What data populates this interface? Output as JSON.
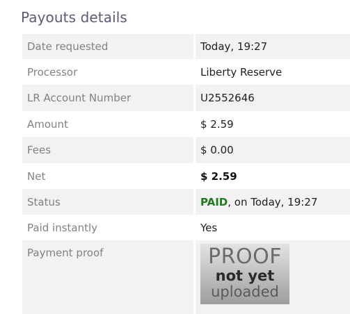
{
  "section": {
    "title": "Payouts details"
  },
  "rows": {
    "date_requested": {
      "label": "Date requested",
      "value": "Today, 19:27"
    },
    "processor": {
      "label": "Processor",
      "value": "Liberty Reserve"
    },
    "account": {
      "label": "LR Account Number",
      "value": "U2552646"
    },
    "amount": {
      "label": "Amount",
      "value": "$ 2.59"
    },
    "fees": {
      "label": "Fees",
      "value": "$ 0.00"
    },
    "net": {
      "label": "Net",
      "value": "$ 2.59"
    },
    "status": {
      "label": "Status",
      "status_word": "PAID",
      "status_suffix": ", on Today, 19:27"
    },
    "paid_instantly": {
      "label": "Paid instantly",
      "value": "Yes"
    },
    "payment_proof": {
      "label": "Payment proof",
      "image_line1": "PROOF",
      "image_line2": "not yet",
      "image_line3": "uploaded"
    }
  },
  "colors": {
    "title": "#5b5b78",
    "label": "#828282",
    "alt_row": "#f2f2f2",
    "paid": "#1e7a1e"
  }
}
